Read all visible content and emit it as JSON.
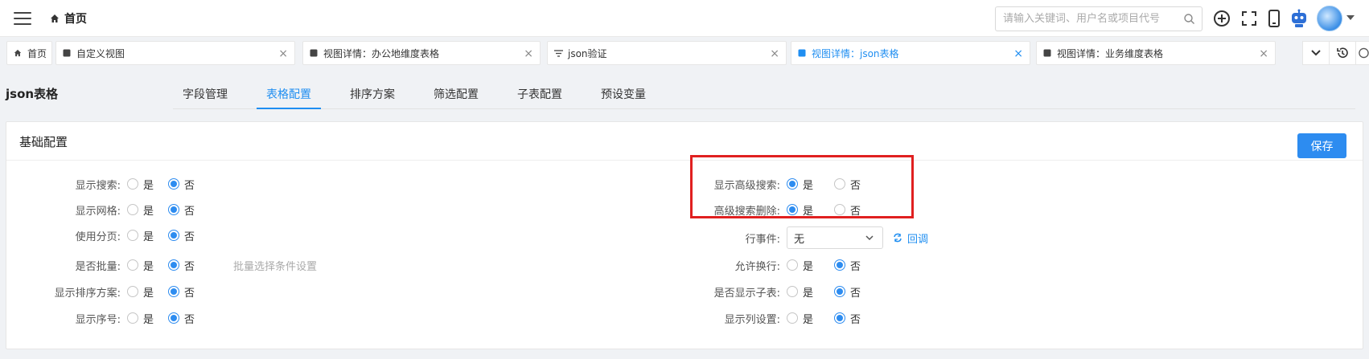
{
  "topbar": {
    "home_label": "首页",
    "search_placeholder": "请输入关键词、用户名或项目代号"
  },
  "tabs": [
    {
      "label": "首页",
      "closable": false,
      "active": false,
      "icon": "home-icon"
    },
    {
      "label": "自定义视图",
      "closable": true,
      "active": false,
      "icon": "view-icon"
    },
    {
      "label": "视图详情：办公地维度表格",
      "closable": true,
      "active": false,
      "icon": "view-icon"
    },
    {
      "label": "json验证",
      "closable": true,
      "active": false,
      "icon": "filter-icon"
    },
    {
      "label": "视图详情：json表格",
      "closable": true,
      "active": true,
      "icon": "view-icon"
    },
    {
      "label": "视图详情：业务维度表格",
      "closable": true,
      "active": false,
      "icon": "view-icon"
    }
  ],
  "page": {
    "title": "json表格",
    "subtabs": [
      "字段管理",
      "表格配置",
      "排序方案",
      "筛选配置",
      "子表配置",
      "预设变量"
    ],
    "active_subtab": "表格配置"
  },
  "panel": {
    "title": "基础配置",
    "save_label": "保存",
    "yes": "是",
    "no": "否",
    "left_rows": [
      {
        "label": "显示搜索:",
        "value": "否"
      },
      {
        "label": "显示网格:",
        "value": "否"
      },
      {
        "label": "使用分页:",
        "value": "否"
      },
      {
        "label": "是否批量:",
        "value": "否",
        "hint": "批量选择条件设置"
      },
      {
        "label": "显示排序方案:",
        "value": "否"
      },
      {
        "label": "显示序号:",
        "value": "否"
      }
    ],
    "right_rows": [
      {
        "label": "显示高级搜索:",
        "value": "是"
      },
      {
        "label": "高级搜索删除:",
        "value": "是"
      },
      {
        "label": "行事件:",
        "type": "select",
        "select_value": "无",
        "callback_label": "回调"
      },
      {
        "label": "允许换行:",
        "value": "否"
      },
      {
        "label": "是否显示子表:",
        "value": "否"
      },
      {
        "label": "显示列设置:",
        "value": "否"
      }
    ]
  },
  "colors": {
    "accent": "#1f8ef1",
    "highlight": "#e02020"
  }
}
